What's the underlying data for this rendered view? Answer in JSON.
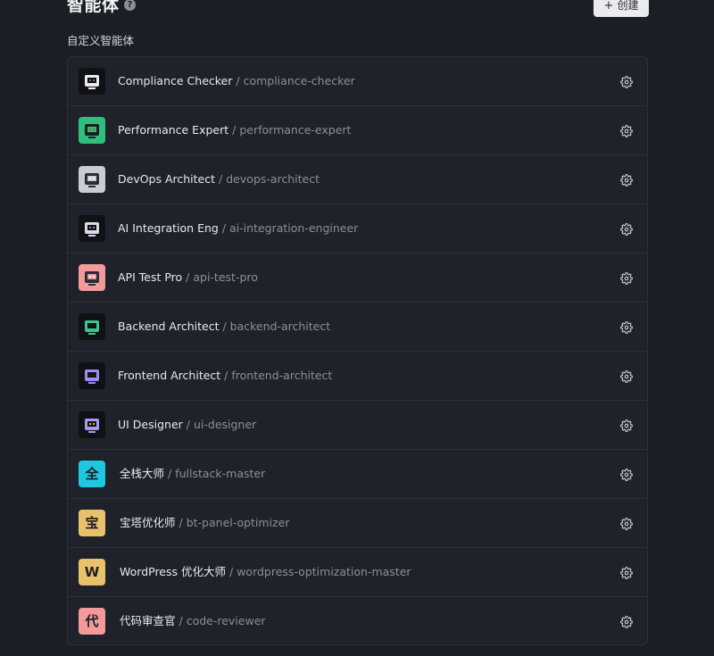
{
  "header": {
    "title": "智能体",
    "help": "?",
    "create_plus": "+",
    "create_label": "创建"
  },
  "section_title": "自定义智能体",
  "separator": "/",
  "agents": [
    {
      "name": "Compliance Checker",
      "id": "compliance-checker",
      "avatar": {
        "type": "robot",
        "bg": "#0f1115",
        "face": "#e8eaee",
        "accent": "#6b6f78"
      }
    },
    {
      "name": "Performance Expert",
      "id": "performance-expert",
      "avatar": {
        "type": "robot",
        "bg": "#2fbf7a",
        "face": "#1a1d24",
        "accent": "#e23b4b"
      }
    },
    {
      "name": "DevOps Architect",
      "id": "devops-architect",
      "avatar": {
        "type": "robot",
        "bg": "#c9ccd2",
        "face": "#2a2d33",
        "accent": "#ffffff"
      }
    },
    {
      "name": "AI Integration Eng",
      "id": "ai-integration-engineer",
      "avatar": {
        "type": "robot",
        "bg": "#0f1115",
        "face": "#d9dbe0",
        "accent": "#8b7cf0"
      }
    },
    {
      "name": "API Test Pro",
      "id": "api-test-pro",
      "avatar": {
        "type": "robot",
        "bg": "#f29a9a",
        "face": "#2a2d33",
        "accent": "#ffffff"
      }
    },
    {
      "name": "Backend Architect",
      "id": "backend-architect",
      "avatar": {
        "type": "robot",
        "bg": "#0f1115",
        "face": "#3cc48a",
        "accent": "#1a1d24"
      }
    },
    {
      "name": "Frontend Architect",
      "id": "frontend-architect",
      "avatar": {
        "type": "robot",
        "bg": "#0f1115",
        "face": "#9d8cf2",
        "accent": "#1a1d24"
      }
    },
    {
      "name": "UI Designer",
      "id": "ui-designer",
      "avatar": {
        "type": "robot",
        "bg": "#0f1115",
        "face": "#a997f5",
        "accent": "#f0b44a"
      }
    },
    {
      "name": "全栈大师",
      "id": "fullstack-master",
      "avatar": {
        "type": "letter",
        "letter": "全",
        "bg": "#1ec8e0"
      }
    },
    {
      "name": "宝塔优化师",
      "id": "bt-panel-optimizer",
      "avatar": {
        "type": "letter",
        "letter": "宝",
        "bg": "#e8c26b"
      }
    },
    {
      "name": "WordPress 优化大师",
      "id": "wordpress-optimization-master",
      "avatar": {
        "type": "letter",
        "letter": "W",
        "bg": "#e8c26b"
      }
    },
    {
      "name": "代码审查官",
      "id": "code-reviewer",
      "avatar": {
        "type": "letter",
        "letter": "代",
        "bg": "#f29a9a"
      }
    }
  ]
}
